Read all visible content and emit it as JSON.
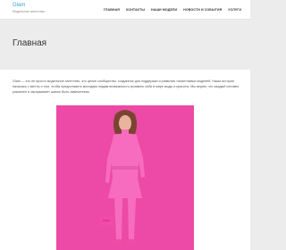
{
  "brand": {
    "name": "Glam",
    "tagline": "Модельное агентство"
  },
  "nav": {
    "items": [
      {
        "label": "Главная"
      },
      {
        "label": "Контакты"
      },
      {
        "label": "Наши модели"
      },
      {
        "label": "Новости и события"
      },
      {
        "label": "Услуги"
      }
    ]
  },
  "page": {
    "title": "Главная",
    "intro": "Glam — это не просто модельное агентство, это целое сообщество, созданное для поддержки и развития талантливых моделей. Наша история началась с мечты о том, чтобы предоставить молодым людям возможность проявить себя в мире моды и красоты. Мы верим, что каждый человек уникален и заслуживает шанса быть замеченным."
  },
  "colors": {
    "brand_accent": "#3aa0e0",
    "photo_background": "#ec4aa6",
    "outfit": "#f76cbf"
  }
}
